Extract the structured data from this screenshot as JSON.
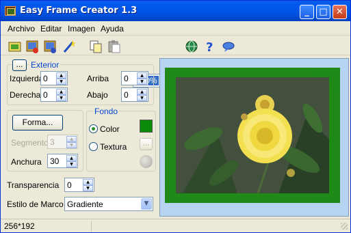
{
  "window": {
    "title": "Easy Frame Creator 1.3"
  },
  "menu": {
    "items": [
      "Archivo",
      "Editar",
      "Imagen",
      "Ayuda"
    ]
  },
  "toolbar": {
    "zoom_value": "100%"
  },
  "exterior": {
    "title": "Exterior",
    "button": "...",
    "izquierda_label": "Izquierda",
    "izquierda": "0",
    "derecha_label": "Derecha",
    "derecha": "0",
    "arriba_label": "Arriba",
    "arriba": "0",
    "abajo_label": "Abajo",
    "abajo": "0"
  },
  "forma": {
    "button": "Forma...",
    "segmentos_label": "Segmentos",
    "segmentos": "3",
    "anchura_label": "Anchura",
    "anchura": "30"
  },
  "fondo": {
    "title": "Fondo",
    "color_label": "Color",
    "textura_label": "Textura",
    "textura_button": "...",
    "color_value": "#0b8a0b",
    "selected": "Color"
  },
  "transparencia": {
    "label": "Transparencia",
    "value": "0"
  },
  "estilo": {
    "label": "Estilo de Marco",
    "value": "Gradiente"
  },
  "status": {
    "text": "256*192"
  },
  "colors": {
    "frame_green": "#208a18",
    "preview_bg": "#b8d4f3",
    "title_blue": "#0054e3"
  }
}
